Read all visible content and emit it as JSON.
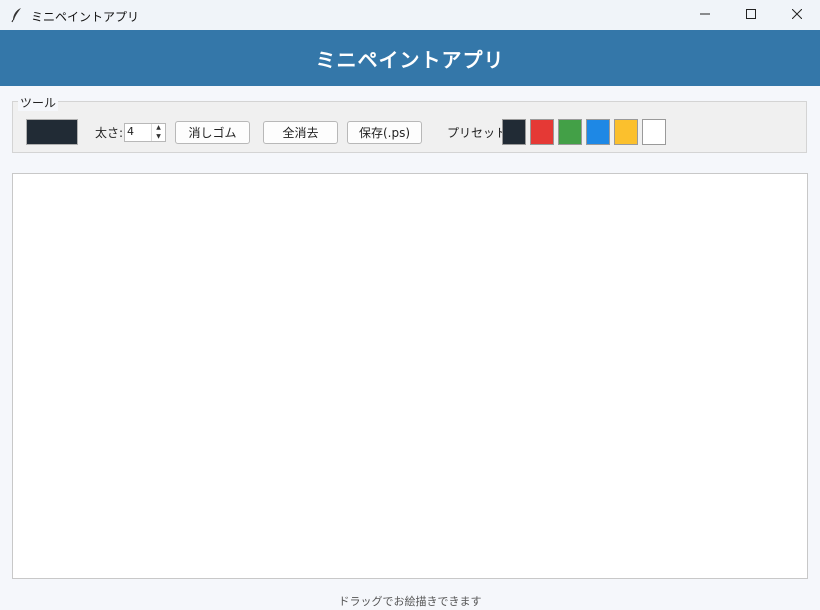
{
  "window": {
    "title": "ミニペイントアプリ",
    "icon": "feather-icon",
    "controls": [
      "minimize-icon",
      "maximize-icon",
      "close-icon"
    ]
  },
  "header": {
    "title": "ミニペイントアプリ",
    "background": "#3477a9"
  },
  "tools": {
    "group_label": "ツール",
    "current_color": "#212b35",
    "size_label": "太さ:",
    "size_value": "4",
    "eraser_label": "消しゴム",
    "clear_label": "全消去",
    "save_label": "保存(.ps)",
    "preset_label": "プリセット:",
    "presets": [
      "#212b35",
      "#e53935",
      "#43a047",
      "#1e88e5",
      "#fbc02d",
      "#ffffff"
    ]
  },
  "canvas": {
    "background": "#ffffff"
  },
  "status": {
    "text": "ドラッグでお絵描きできます"
  }
}
